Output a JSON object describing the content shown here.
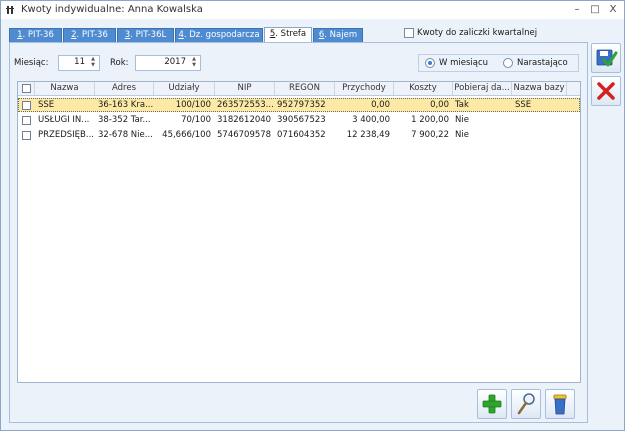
{
  "window": {
    "title": "Kwoty indywidualne: Anna Kowalska",
    "minimize": "–",
    "maximize": "□",
    "close": "X"
  },
  "tabs": [
    {
      "num": "1",
      "label": ". PIT-36"
    },
    {
      "num": "2",
      "label": ". PIT-36"
    },
    {
      "num": "3",
      "label": ". PIT-36L"
    },
    {
      "num": "4",
      "label": ". Dz. gospodarcza"
    },
    {
      "num": "5",
      "label": ". Strefa"
    },
    {
      "num": "6",
      "label": ". Najem"
    }
  ],
  "active_tab": 4,
  "quarterly_checkbox": {
    "label": "Kwoty do zaliczki kwartalnej",
    "checked": false
  },
  "filters": {
    "month_label": "Miesiąc:",
    "month_value": "11",
    "year_label": "Rok:",
    "year_value": "2017"
  },
  "mode": {
    "monthly_label": "W miesiącu",
    "cumulative_label": "Narastająco",
    "selected": "monthly"
  },
  "grid": {
    "columns": [
      "Nazwa",
      "Adres",
      "Udziały",
      "NIP",
      "REGON",
      "Przychody",
      "Koszty",
      "Pobieraj da...",
      "Nazwa bazy"
    ],
    "rows": [
      {
        "nazwa": "SSE",
        "adres": "36-163 Kra...",
        "udzialy": "100/100",
        "nip": "263572553...",
        "regon": "952797352",
        "przychody": "0,00",
        "koszty": "0,00",
        "pobieraj": "Tak",
        "baza": "SSE"
      },
      {
        "nazwa": "USŁUGI IN...",
        "adres": "38-352 Tar...",
        "udzialy": "70/100",
        "nip": "3182612040",
        "regon": "390567523",
        "przychody": "3 400,00",
        "koszty": "1 200,00",
        "pobieraj": "Nie",
        "baza": ""
      },
      {
        "nazwa": "PRZEDSIĘB...",
        "adres": "32-678 Nie...",
        "udzialy": "45,666/100",
        "nip": "5746709578",
        "regon": "071604352",
        "przychody": "12 238,49",
        "koszty": "7 900,22",
        "pobieraj": "Nie",
        "baza": ""
      }
    ],
    "selected_row": 0
  },
  "colors": {
    "tab_blue": "#4f8bd1",
    "selected_row": "#fde9a6",
    "panel_bg": "#ecf2fa"
  },
  "icons": {
    "save": "save-disk-icon",
    "cancel": "cancel-x-icon",
    "add": "green-plus-icon",
    "edit": "magnifier-icon",
    "delete": "trash-bin-icon"
  }
}
